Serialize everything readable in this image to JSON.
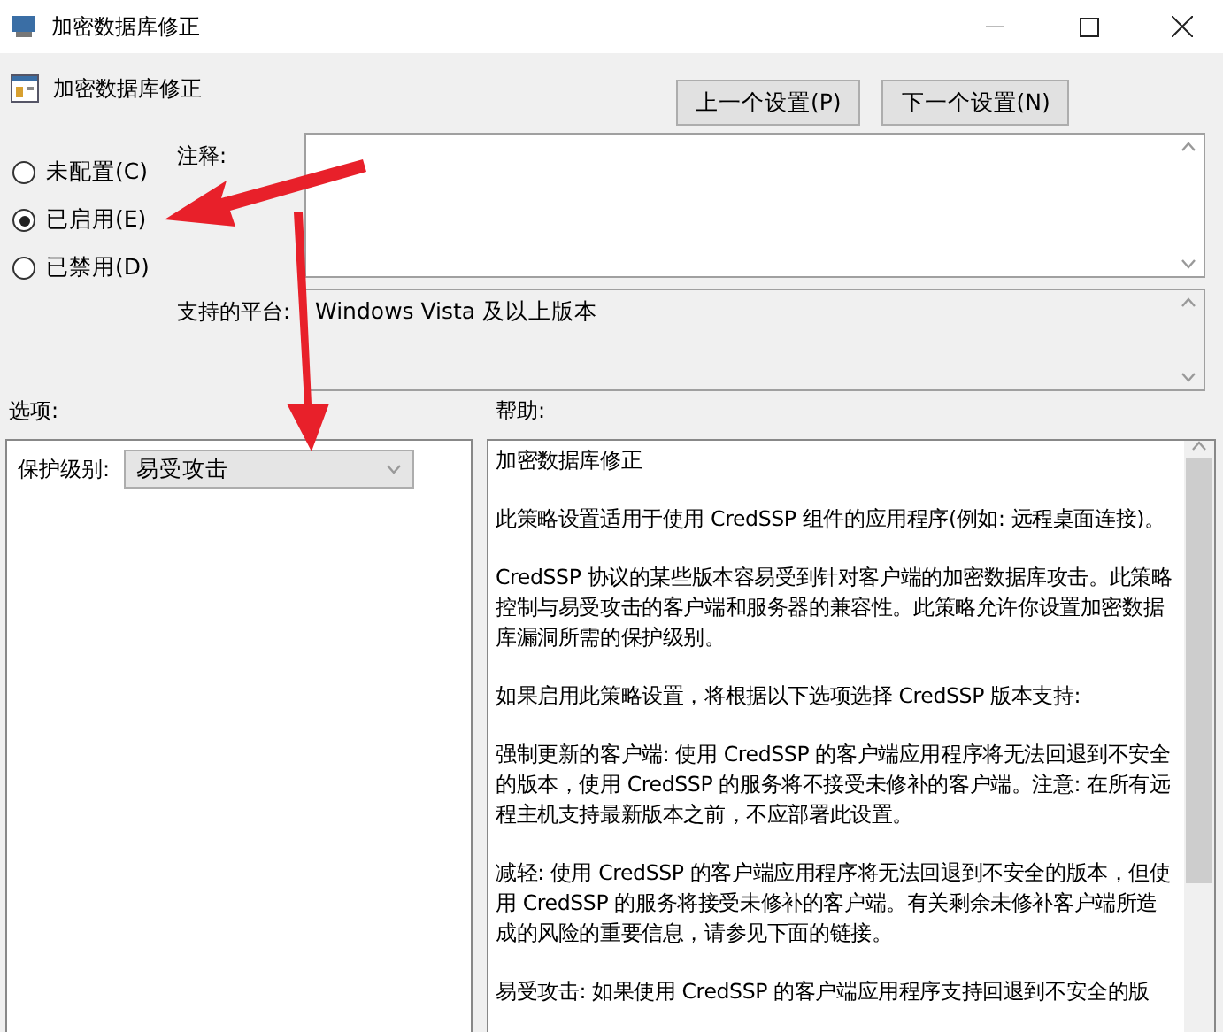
{
  "window": {
    "title": "加密数据库修正"
  },
  "header": {
    "title": "加密数据库修正"
  },
  "nav_buttons": [
    {
      "label": "上一个设置(P)"
    },
    {
      "label": "下一个设置(N)"
    }
  ],
  "states": [
    {
      "label": "未配置(C)",
      "selected": false
    },
    {
      "label": "已启用(E)",
      "selected": true
    },
    {
      "label": "已禁用(D)",
      "selected": false
    }
  ],
  "comment": {
    "label": "注释:"
  },
  "platform": {
    "label": "支持的平台:",
    "value": "Windows Vista 及以上版本"
  },
  "options": {
    "label": "选项:",
    "field_label": "保护级别:",
    "value": "易受攻击"
  },
  "help": {
    "label": "帮助:",
    "paragraphs": [
      "加密数据库修正",
      "此策略设置适用于使用 CredSSP 组件的应用程序(例如: 远程桌面连接)。",
      "CredSSP 协议的某些版本容易受到针对客户端的加密数据库攻击。此策略控制与易受攻击的客户端和服务器的兼容性。此策略允许你设置加密数据库漏洞所需的保护级别。",
      "如果启用此策略设置，将根据以下选项选择 CredSSP 版本支持:",
      "强制更新的客户端: 使用 CredSSP 的客户端应用程序将无法回退到不安全的版本，使用 CredSSP 的服务将不接受未修补的客户端。注意: 在所有远程主机支持最新版本之前，不应部署此设置。",
      "减轻: 使用 CredSSP 的客户端应用程序将无法回退到不安全的版本，但使用 CredSSP 的服务将接受未修补的客户端。有关剩余未修补客户端所造成的风险的重要信息，请参见下面的链接。",
      "易受攻击: 如果使用 CredSSP 的客户端应用程序支持回退到不安全的版"
    ]
  }
}
